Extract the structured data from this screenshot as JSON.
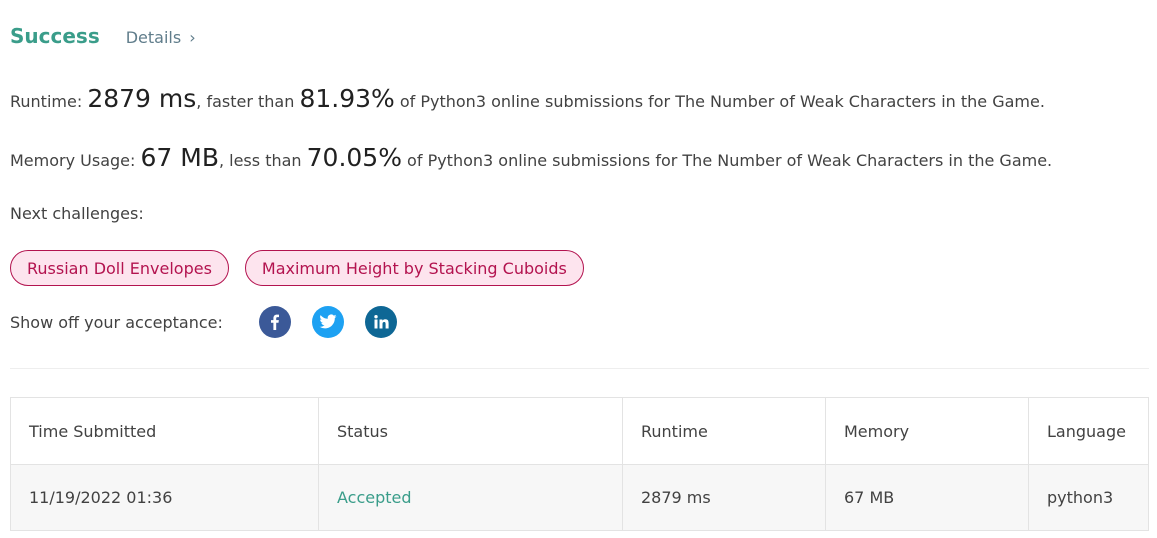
{
  "header": {
    "status_title": "Success",
    "details_link": "Details",
    "details_chevron": "›"
  },
  "runtime": {
    "label": "Runtime: ",
    "value": "2879 ms",
    "comparison_prefix": ", faster than ",
    "percentile": "81.93%",
    "suffix": " of Python3 online submissions for The Number of Weak Characters in the Game."
  },
  "memory": {
    "label": "Memory Usage: ",
    "value": "67 MB",
    "comparison_prefix": ", less than ",
    "percentile": "70.05%",
    "suffix": " of Python3 online submissions for The Number of Weak Characters in the Game."
  },
  "next_challenges": {
    "label": "Next challenges:",
    "items": [
      {
        "label": "Russian Doll Envelopes"
      },
      {
        "label": "Maximum Height by Stacking Cuboids"
      }
    ]
  },
  "share": {
    "label": "Show off your acceptance:",
    "icons": [
      {
        "name": "facebook-icon",
        "color": "#3b5998"
      },
      {
        "name": "twitter-icon",
        "color": "#1da1f2"
      },
      {
        "name": "linkedin-icon",
        "color": "#0e6795"
      }
    ]
  },
  "submissions_table": {
    "columns": [
      "Time Submitted",
      "Status",
      "Runtime",
      "Memory",
      "Language"
    ],
    "rows": [
      {
        "time_submitted": "11/19/2022 01:36",
        "status": "Accepted",
        "runtime": "2879 ms",
        "memory": "67 MB",
        "language": "python3"
      }
    ]
  },
  "colors": {
    "success": "#3a9d8a",
    "chip_text": "#b3134f",
    "chip_bg": "#fde4ee"
  }
}
